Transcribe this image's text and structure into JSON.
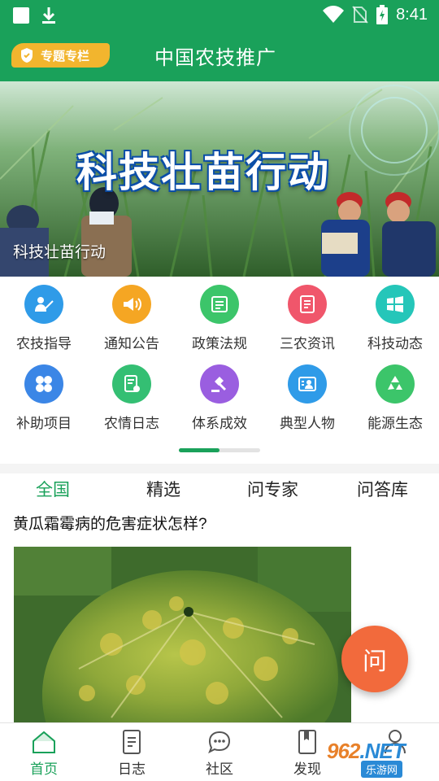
{
  "status_bar": {
    "time": "8:41",
    "icons": [
      "notification-square-icon",
      "download-icon",
      "wifi-icon",
      "no-sim-icon",
      "battery-charging-icon"
    ]
  },
  "app_bar": {
    "badge_label": "专题专栏",
    "title": "中国农技推广"
  },
  "banner": {
    "heading": "科技壮苗行动",
    "caption": "科技壮苗行动"
  },
  "grid": {
    "items": [
      {
        "label": "农技指导",
        "icon": "teacher-icon",
        "color": "#2f9be8"
      },
      {
        "label": "通知公告",
        "icon": "speaker-icon",
        "color": "#f5a623"
      },
      {
        "label": "政策法规",
        "icon": "book-icon",
        "color": "#3cc56a"
      },
      {
        "label": "三农资讯",
        "icon": "news-icon",
        "color": "#f0566b"
      },
      {
        "label": "科技动态",
        "icon": "windows-icon",
        "color": "#25c6b9"
      },
      {
        "label": "补助项目",
        "icon": "apps-icon",
        "color": "#3b86e6"
      },
      {
        "label": "农情日志",
        "icon": "log-icon",
        "color": "#34bf73"
      },
      {
        "label": "体系成效",
        "icon": "gavel-icon",
        "color": "#9a5ee0"
      },
      {
        "label": "典型人物",
        "icon": "person-card-icon",
        "color": "#2f9be8"
      },
      {
        "label": "能源生态",
        "icon": "recycle-icon",
        "color": "#3cc56a"
      }
    ],
    "page_progress": 0.5
  },
  "tabs": [
    {
      "label": "全国",
      "active": true
    },
    {
      "label": "精选",
      "active": false
    },
    {
      "label": "问专家",
      "active": false
    },
    {
      "label": "问答库",
      "active": false
    }
  ],
  "question_title": "黄瓜霜霉病的危害症状怎样?",
  "fab_label": "问",
  "bottom_nav": [
    {
      "label": "首页",
      "icon": "home-icon",
      "active": true
    },
    {
      "label": "日志",
      "icon": "journal-icon",
      "active": false
    },
    {
      "label": "社区",
      "icon": "chat-icon",
      "active": false
    },
    {
      "label": "发现",
      "icon": "discover-icon",
      "active": false
    },
    {
      "label": "",
      "icon": "profile-icon",
      "active": false
    }
  ],
  "watermark": {
    "top": "962",
    "top_suffix": ".NET",
    "bottom": "乐游网"
  },
  "colors": {
    "brand": "#1aa15a",
    "badge": "#f2b52e",
    "fab": "#f26a3c"
  }
}
